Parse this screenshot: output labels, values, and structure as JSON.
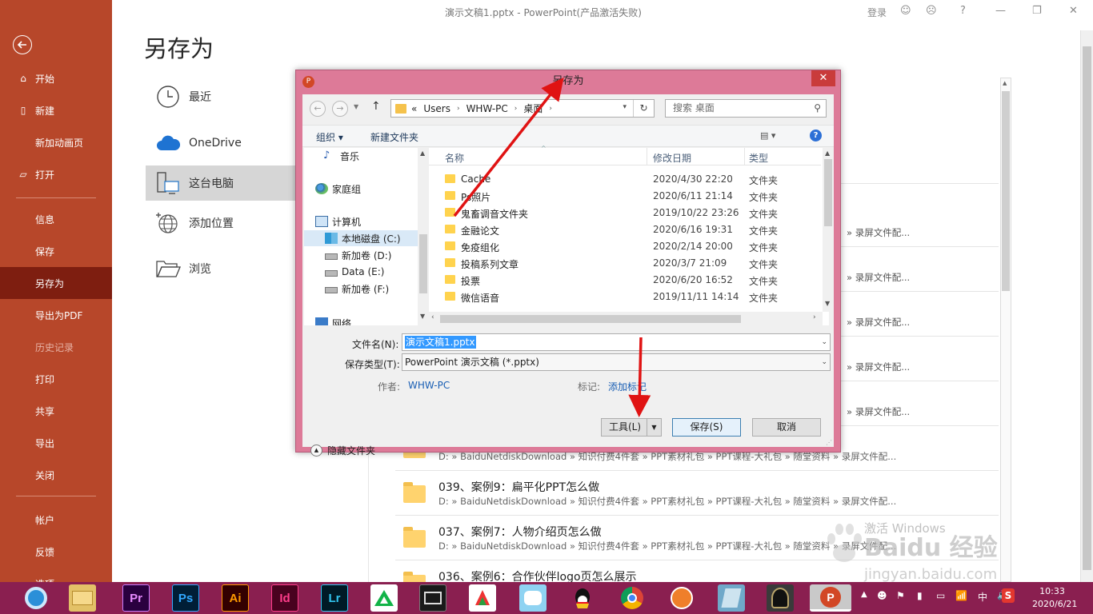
{
  "window": {
    "title": "演示文稿1.pptx  -  PowerPoint(产品激活失败)",
    "signin": "登录",
    "help": "?",
    "minimize": "—",
    "restore": "❐",
    "close": "✕"
  },
  "backstage": {
    "items": [
      {
        "label": "开始",
        "icon": "home-icon"
      },
      {
        "label": "新建",
        "icon": "new-doc-icon"
      },
      {
        "label": "新加动画页"
      },
      {
        "label": "打开",
        "icon": "open-folder-icon"
      },
      {
        "label": "信息"
      },
      {
        "label": "保存"
      },
      {
        "label": "另存为"
      },
      {
        "label": "导出为PDF"
      },
      {
        "label": "历史记录"
      },
      {
        "label": "打印"
      },
      {
        "label": "共享"
      },
      {
        "label": "导出"
      },
      {
        "label": "关闭"
      },
      {
        "label": "帐户"
      },
      {
        "label": "反馈"
      },
      {
        "label": "选项"
      }
    ]
  },
  "saveas": {
    "title": "另存为",
    "locations": [
      {
        "label": "最近",
        "icon": "clock-icon"
      },
      {
        "label": "OneDrive",
        "icon": "cloud-icon"
      },
      {
        "label": "这台电脑",
        "icon": "computer-icon"
      },
      {
        "label": "添加位置",
        "icon": "globe-add-icon"
      },
      {
        "label": "浏览",
        "icon": "folder-open-icon"
      }
    ]
  },
  "recent": {
    "tail": "» 录屏文件配...",
    "rows": [
      {
        "name": "",
        "path": "D: » BaiduNetdiskDownload » 知识付费4件套 » PPT素材礼包 » PPT课程-大礼包 » 随堂资料 » 录屏文件配..."
      },
      {
        "name": "039、案例9：扁平化PPT怎么做",
        "path": "D: » BaiduNetdiskDownload » 知识付费4件套 » PPT素材礼包 » PPT课程-大礼包 » 随堂资料 » 录屏文件配..."
      },
      {
        "name": "037、案例7：人物介绍页怎么做",
        "path": "D: » BaiduNetdiskDownload » 知识付费4件套 » PPT素材礼包 » PPT课程-大礼包 » 随堂资料 » 录屏文件配..."
      },
      {
        "name": "036、案例6：合作伙伴logo页怎么展示",
        "path": ""
      }
    ]
  },
  "dialog": {
    "title": "另存为",
    "close": "✕",
    "app_logo": "P",
    "address": [
      "«",
      "Users",
      "WHW-PC",
      "桌面"
    ],
    "search_placeholder": "搜索 桌面",
    "organize": "组织 ▾",
    "new_folder": "新建文件夹",
    "tree": [
      {
        "label": "音乐"
      },
      {
        "label": "家庭组"
      },
      {
        "label": "计算机"
      },
      {
        "label": "本地磁盘 (C:)"
      },
      {
        "label": "新加卷 (D:)"
      },
      {
        "label": "Data (E:)"
      },
      {
        "label": "新加卷 (F:)"
      },
      {
        "label": "网络"
      }
    ],
    "columns": {
      "name": "名称",
      "date": "修改日期",
      "type": "类型"
    },
    "files": [
      {
        "name": "Cache",
        "date": "2020/4/30 22:20",
        "type": "文件夹"
      },
      {
        "name": "Ps照片",
        "date": "2020/6/11 21:14",
        "type": "文件夹"
      },
      {
        "name": "鬼畜调音文件夹",
        "date": "2019/10/22 23:26",
        "type": "文件夹"
      },
      {
        "name": "金融论文",
        "date": "2020/6/16 19:31",
        "type": "文件夹"
      },
      {
        "name": "免疫组化",
        "date": "2020/2/14 20:00",
        "type": "文件夹"
      },
      {
        "name": "投稿系列文章",
        "date": "2020/3/7 21:09",
        "type": "文件夹"
      },
      {
        "name": "投票",
        "date": "2020/6/20 16:52",
        "type": "文件夹"
      },
      {
        "name": "微信语音",
        "date": "2019/11/11 14:14",
        "type": "文件夹"
      }
    ],
    "filename_label": "文件名(N):",
    "filename_value": "演示文稿1.pptx",
    "filetype_label": "保存类型(T):",
    "filetype_value": "PowerPoint 演示文稿 (*.pptx)",
    "author_label": "作者:",
    "author_value": "WHW-PC",
    "tags_label": "标记:",
    "tags_value": "添加标记",
    "hide_folders": "隐藏文件夹",
    "tools": "工具(L)",
    "save": "保存(S)",
    "cancel": "取消"
  },
  "watermark": {
    "brand": "Baidu 经验",
    "url": "jingyan.baidu.com",
    "activate": "激活 Windows"
  },
  "taskbar": {
    "apps": [
      "Pr",
      "Ps",
      "Ai",
      "Id",
      "Lr"
    ],
    "ime": "中",
    "time": "10:33",
    "date": "2020/6/21"
  }
}
